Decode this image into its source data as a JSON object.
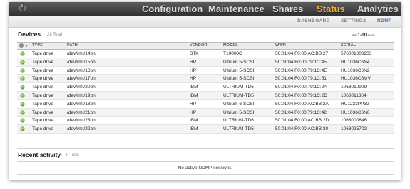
{
  "topnav": {
    "items": [
      "Configuration",
      "Maintenance",
      "Shares",
      "Status",
      "Analytics"
    ],
    "active": "Status"
  },
  "subnav": {
    "items": [
      "DASHBOARD",
      "SETTINGS",
      "NDMP"
    ],
    "active": "NDMP"
  },
  "devices": {
    "title": "Devices",
    "count": "28 Total",
    "pager": "1-10",
    "columns": [
      "TYPE",
      "PATH",
      "VENDOR",
      "MODEL",
      "WWN",
      "SERIAL"
    ],
    "rows": [
      {
        "status": "online",
        "type": "Tape drive",
        "path": "/dev/rmt/14bn",
        "vendor": "STK",
        "model": "T10000C",
        "wwn": "50:01:04:F0:00:AC:BB:27",
        "serial": "576001000203"
      },
      {
        "status": "online",
        "type": "Tape drive",
        "path": "/dev/rmt/15bn",
        "vendor": "HP",
        "model": "Ultrium 5-SCSI",
        "wwn": "50:01:04:F0:00:79:1C:45",
        "serial": "HU1036C6N4"
      },
      {
        "status": "online",
        "type": "Tape drive",
        "path": "/dev/rmt/16bn",
        "vendor": "HP",
        "model": "Ultrium 5-SCSI",
        "wwn": "50:01:04:F0:00:79:1C:4E",
        "serial": "HU1036C6N2"
      },
      {
        "status": "online",
        "type": "Tape drive",
        "path": "/dev/rmt/17bn",
        "vendor": "HP",
        "model": "Ultrium 5-SCSI",
        "wwn": "50:01:04:F0:00:79:1C:51",
        "serial": "HU1036C6MV"
      },
      {
        "status": "online",
        "type": "Tape drive",
        "path": "/dev/rmt/20bn",
        "vendor": "IBM",
        "model": "ULTRIUM-TD5",
        "wwn": "50:01:04:F0:00:79:1C:2A",
        "serial": "1068010909"
      },
      {
        "status": "online",
        "type": "Tape drive",
        "path": "/dev/rmt/19bn",
        "vendor": "IBM",
        "model": "ULTRIUM-TD5",
        "wwn": "50:01:04:F0:00:79:1C:2D",
        "serial": "1068011364"
      },
      {
        "status": "online",
        "type": "Tape drive",
        "path": "/dev/rmt/18bn",
        "vendor": "HP",
        "model": "Ultrium 6-SCSI",
        "wwn": "50:01:04:F0:00:AC:BB:2A",
        "serial": "HU1233PP32"
      },
      {
        "status": "online",
        "type": "Tape drive",
        "path": "/dev/rmt/21bn",
        "vendor": "HP",
        "model": "Ultrium 5-SCSI",
        "wwn": "50:01:04:F0:00:79:1C:42",
        "serial": "HU1036C6N0"
      },
      {
        "status": "online",
        "type": "Tape drive",
        "path": "/dev/rmt/23bn",
        "vendor": "IBM",
        "model": "ULTRIUM-TD6",
        "wwn": "50:01:04:F0:00:AC:BB:2D",
        "serial": "1068000648"
      },
      {
        "status": "online",
        "type": "Tape drive",
        "path": "/dev/rmt/22bn",
        "vendor": "IBM",
        "model": "ULTRIUM-TD5",
        "wwn": "50:01:04:F0:00:AC:BB:30",
        "serial": "1068025702"
      }
    ]
  },
  "recent": {
    "title": "Recent activity",
    "count": "0 Total",
    "empty_message": "No active NDMP sessions."
  },
  "colors": {
    "active_nav": "#f2b43a",
    "active_subnav": "#3a6fa6",
    "status_online": "#5aa21a"
  },
  "icons": {
    "power": "power-icon",
    "status": "status-dot-icon",
    "pager_next": "next-page-icon",
    "pager_last": "last-page-icon",
    "sort": "sort-icon"
  }
}
